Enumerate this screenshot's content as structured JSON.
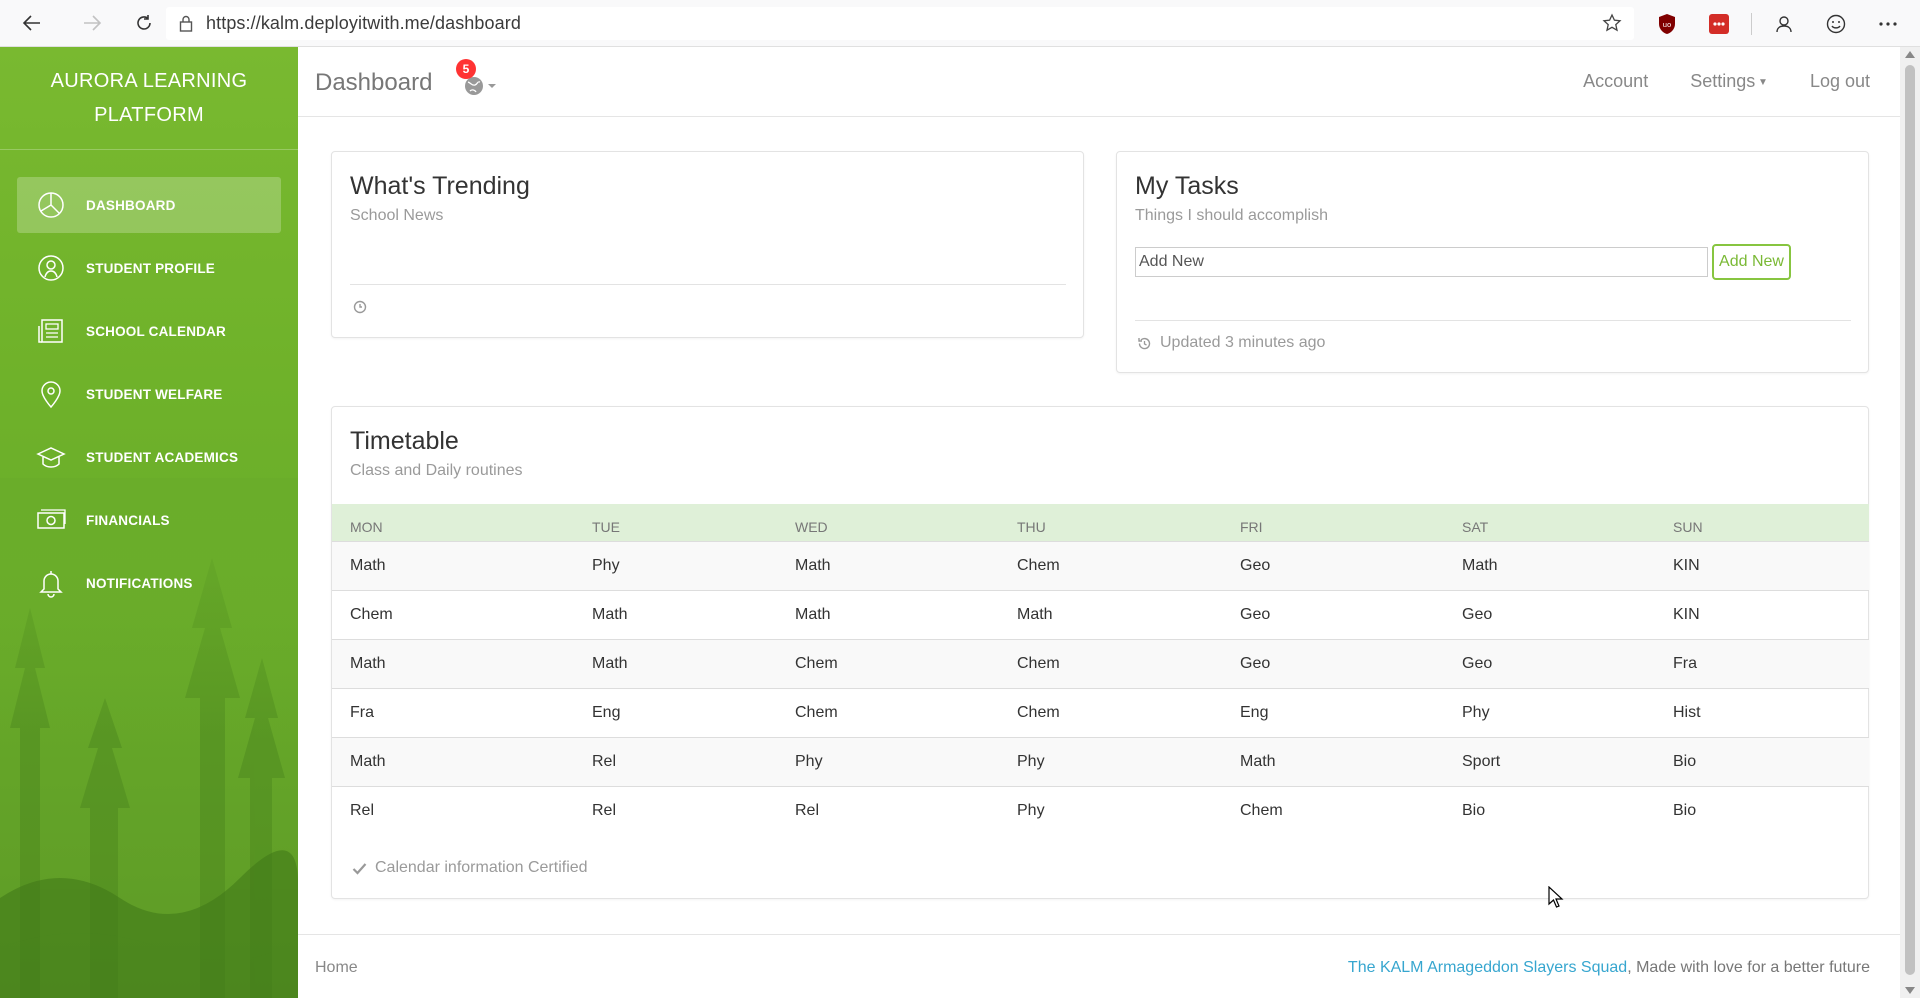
{
  "browser": {
    "url": "https://kalm.deployitwith.me/dashboard"
  },
  "sidebar": {
    "brand": "AURORA LEARNING PLATFORM",
    "items": [
      {
        "label": "DASHBOARD",
        "icon": "pie-chart-icon",
        "active": true
      },
      {
        "label": "STUDENT PROFILE",
        "icon": "user-icon"
      },
      {
        "label": "SCHOOL CALENDAR",
        "icon": "news-icon"
      },
      {
        "label": "STUDENT WELFARE",
        "icon": "map-pin-icon"
      },
      {
        "label": "STUDENT ACADEMICS",
        "icon": "graduation-cap-icon"
      },
      {
        "label": "FINANCIALS",
        "icon": "money-icon"
      },
      {
        "label": "NOTIFICATIONS",
        "icon": "bell-icon"
      }
    ]
  },
  "topnav": {
    "title": "Dashboard",
    "notification_count": "5",
    "account": "Account",
    "settings": "Settings",
    "logout": "Log out"
  },
  "trending": {
    "title": "What's Trending",
    "subtitle": "School News"
  },
  "tasks": {
    "title": "My Tasks",
    "subtitle": "Things I should accomplish",
    "input_value": "Add New",
    "button": "Add New",
    "updated": "Updated 3 minutes ago"
  },
  "timetable": {
    "title": "Timetable",
    "subtitle": "Class and Daily routines",
    "headers": [
      "MON",
      "TUE",
      "WED",
      "THU",
      "FRI",
      "SAT",
      "SUN"
    ],
    "rows": [
      [
        "Math",
        "Phy",
        "Math",
        "Chem",
        "Geo",
        "Math",
        "KIN"
      ],
      [
        "Chem",
        "Math",
        "Math",
        "Math",
        "Geo",
        "Geo",
        "KIN"
      ],
      [
        "Math",
        "Math",
        "Chem",
        "Chem",
        "Geo",
        "Geo",
        "Fra"
      ],
      [
        "Fra",
        "Eng",
        "Chem",
        "Chem",
        "Eng",
        "Phy",
        "Hist"
      ],
      [
        "Math",
        "Rel",
        "Phy",
        "Phy",
        "Math",
        "Sport",
        "Bio"
      ],
      [
        "Rel",
        "Rel",
        "Rel",
        "Phy",
        "Chem",
        "Bio",
        "Bio"
      ]
    ],
    "footer": "Calendar information Certified"
  },
  "footer": {
    "home": "Home",
    "team_link": "The KALM Armageddon Slayers Squad",
    "tagline": ", Made with love for a better future"
  },
  "colors": {
    "sidebar_green": "#6fb22a",
    "table_header": "#dff0d8",
    "badge_red": "#ff3333",
    "link_blue": "#37a6cf",
    "button_green": "#87c540"
  }
}
